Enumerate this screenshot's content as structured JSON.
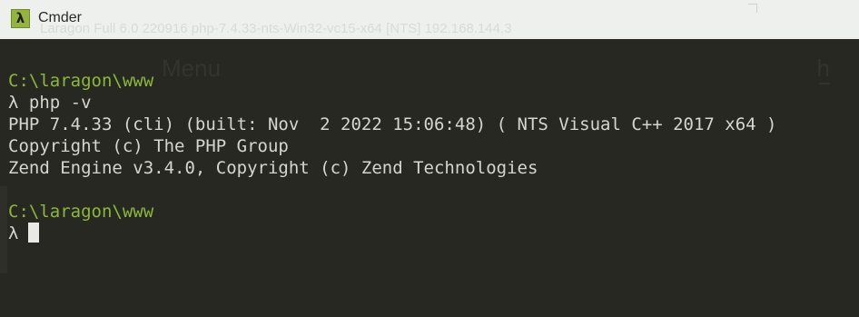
{
  "window": {
    "title": "Cmder",
    "icon_glyph": "λ",
    "background_title": "Laragon Full 6.0 220916 php-7.4.33-nts-Win32-vc15-x64 [NTS]  192.168.144.3"
  },
  "background_app": {
    "menu_label": "Menu",
    "side_label": "h"
  },
  "terminal": {
    "prompt_symbol": "λ",
    "lines": [
      {
        "type": "prompt_path",
        "text": "C:\\laragon\\www"
      },
      {
        "type": "command",
        "text": "php -v"
      },
      {
        "type": "output",
        "text": "PHP 7.4.33 (cli) (built: Nov  2 2022 15:06:48) ( NTS Visual C++ 2017 x64 )"
      },
      {
        "type": "output",
        "text": "Copyright (c) The PHP Group"
      },
      {
        "type": "output",
        "text": "Zend Engine v3.4.0, Copyright (c) Zend Technologies"
      },
      {
        "type": "blank",
        "text": ""
      },
      {
        "type": "prompt_path",
        "text": "C:\\laragon\\www"
      },
      {
        "type": "command",
        "text": ""
      }
    ]
  },
  "colors": {
    "terminal_bg": "#272822",
    "terminal_fg": "#d6d6d0",
    "prompt_path": "#8bb73b",
    "titlebar_bg": "#eef0ee",
    "icon_bg": "#94b33f",
    "cursor": "#e8e8e4"
  }
}
